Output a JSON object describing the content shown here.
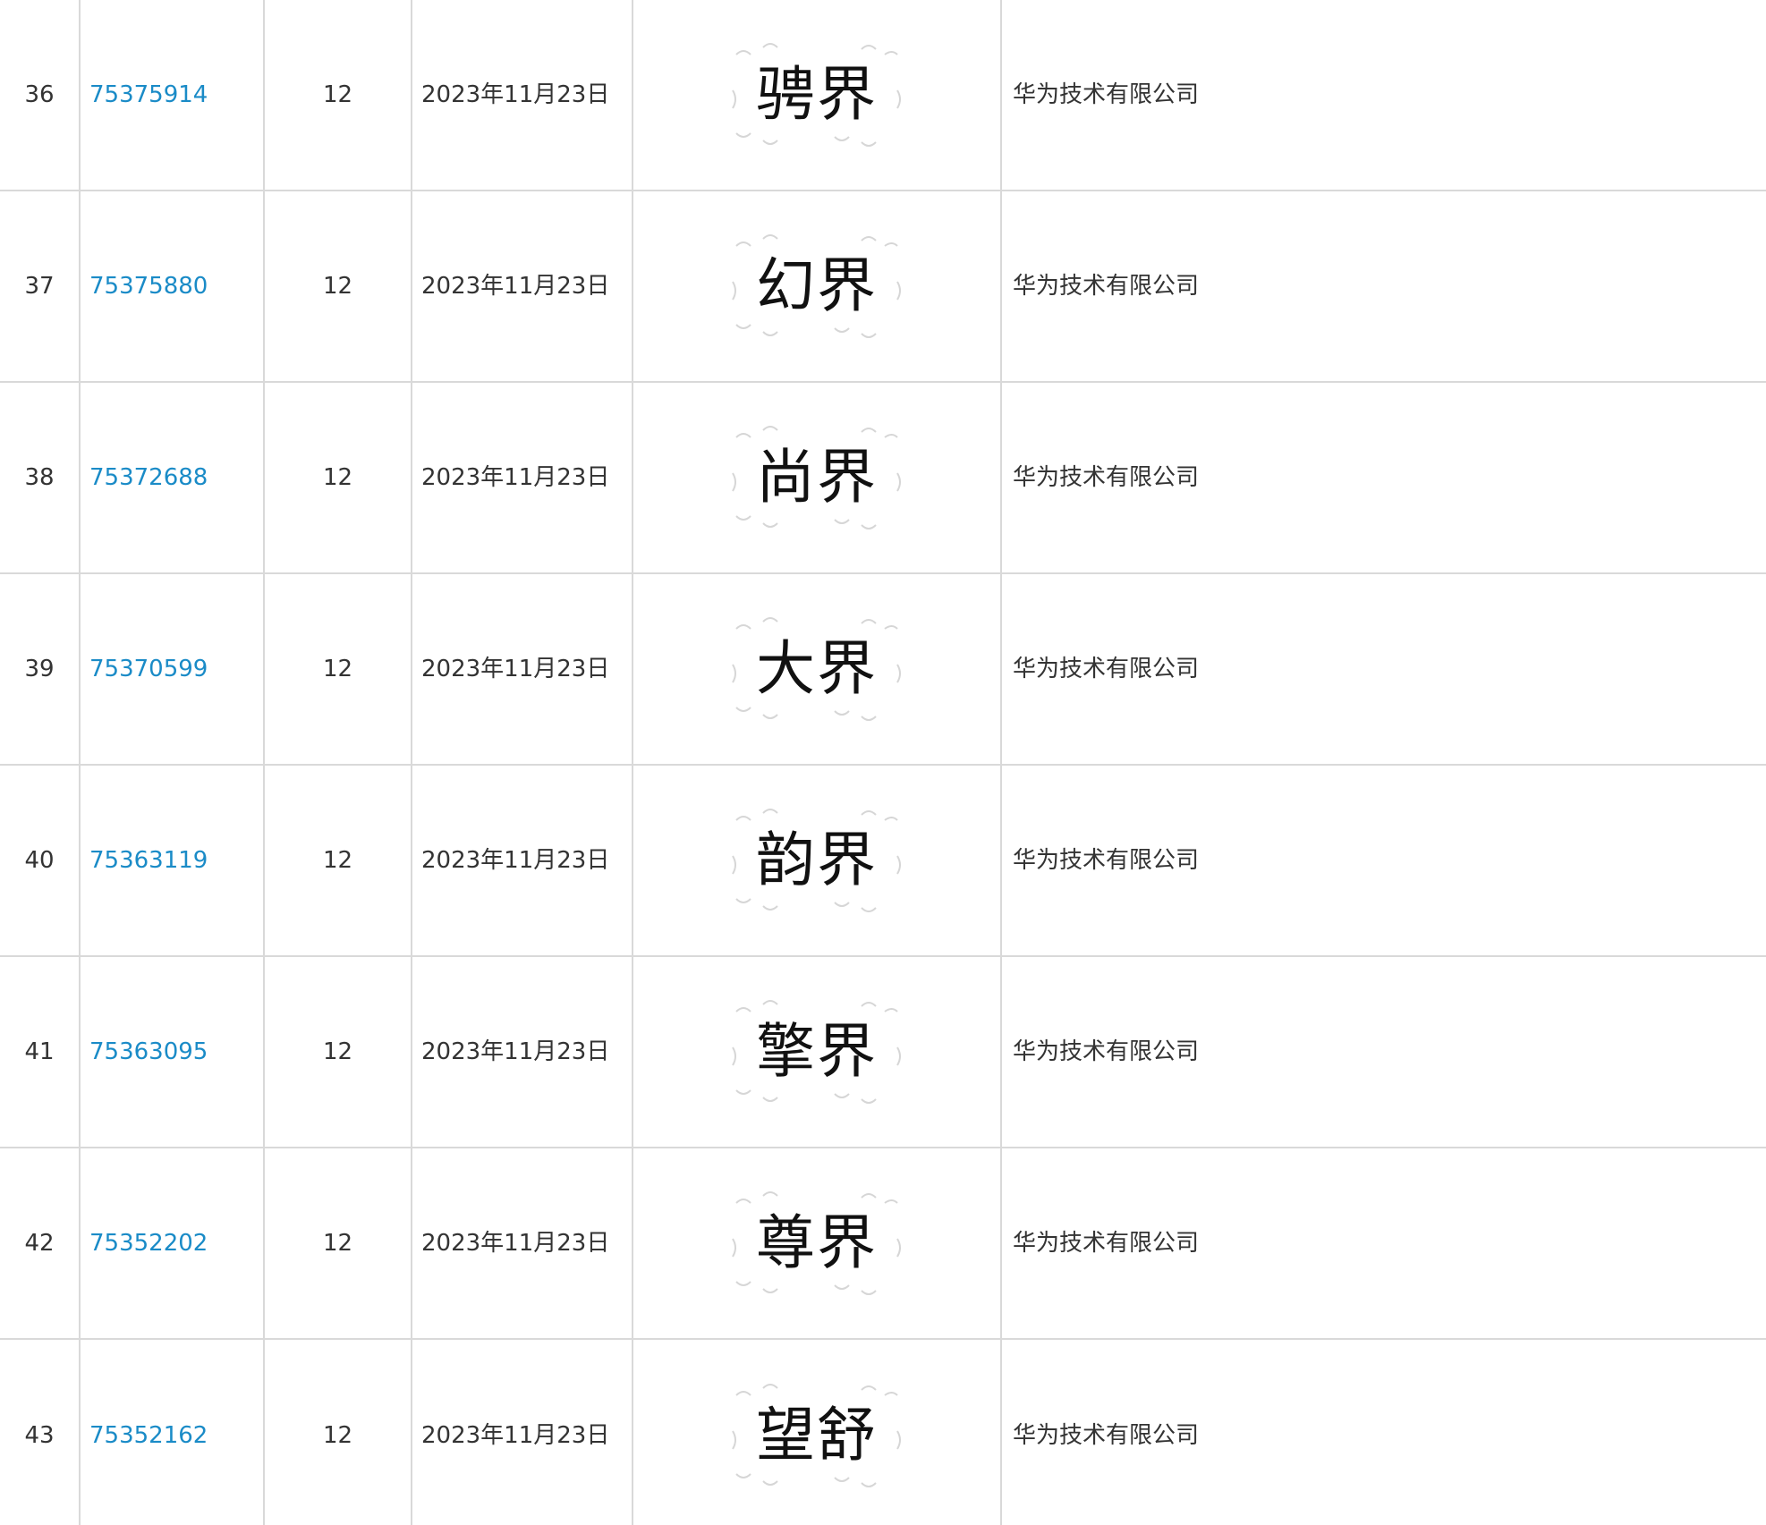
{
  "rows": [
    {
      "index": "36",
      "reg_no": "75375914",
      "class": "12",
      "date": "2023年11月23日",
      "mark": "骋界",
      "owner": "华为技术有限公司"
    },
    {
      "index": "37",
      "reg_no": "75375880",
      "class": "12",
      "date": "2023年11月23日",
      "mark": "幻界",
      "owner": "华为技术有限公司"
    },
    {
      "index": "38",
      "reg_no": "75372688",
      "class": "12",
      "date": "2023年11月23日",
      "mark": "尚界",
      "owner": "华为技术有限公司"
    },
    {
      "index": "39",
      "reg_no": "75370599",
      "class": "12",
      "date": "2023年11月23日",
      "mark": "大界",
      "owner": "华为技术有限公司"
    },
    {
      "index": "40",
      "reg_no": "75363119",
      "class": "12",
      "date": "2023年11月23日",
      "mark": "韵界",
      "owner": "华为技术有限公司"
    },
    {
      "index": "41",
      "reg_no": "75363095",
      "class": "12",
      "date": "2023年11月23日",
      "mark": "擎界",
      "owner": "华为技术有限公司"
    },
    {
      "index": "42",
      "reg_no": "75352202",
      "class": "12",
      "date": "2023年11月23日",
      "mark": "尊界",
      "owner": "华为技术有限公司"
    },
    {
      "index": "43",
      "reg_no": "75352162",
      "class": "12",
      "date": "2023年11月23日",
      "mark": "望舒",
      "owner": "华为技术有限公司"
    }
  ],
  "colors": {
    "link": "#1a8bc7",
    "grid": "#d9d9d9",
    "text": "#333333"
  }
}
